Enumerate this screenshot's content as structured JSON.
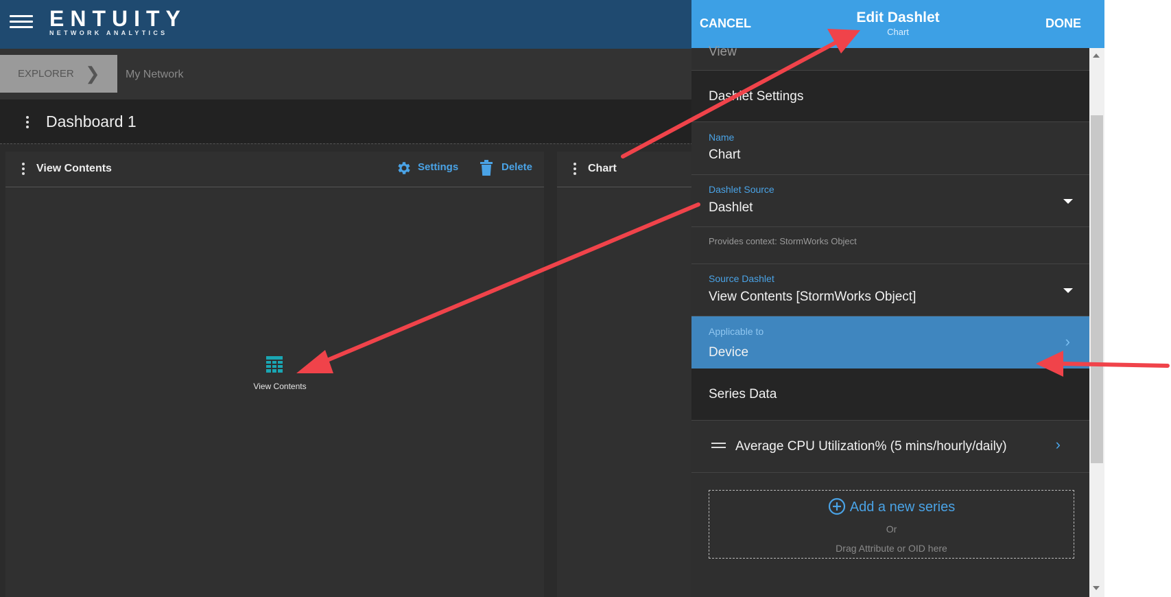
{
  "header": {
    "brand_name": "ENTUITY",
    "brand_tagline": "NETWORK ANALYTICS"
  },
  "breadcrumb": {
    "explorer_label": "EXPLORER",
    "current": "My Network"
  },
  "dashboard": {
    "title": "Dashboard 1"
  },
  "cards": [
    {
      "title": "View Contents",
      "settings_label": "Settings",
      "delete_label": "Delete",
      "content_icon": "table-grid-icon",
      "content_label": "View Contents"
    },
    {
      "title": "Chart"
    }
  ],
  "panel": {
    "cancel_label": "CANCEL",
    "done_label": "DONE",
    "title": "Edit Dashlet",
    "subtitle": "Chart",
    "partial_section": "View",
    "dashlet_settings_title": "Dashlet Settings",
    "name": {
      "label": "Name",
      "value": "Chart"
    },
    "dashlet_source": {
      "label": "Dashlet Source",
      "value": "Dashlet"
    },
    "context_note": "Provides context: StormWorks Object",
    "source_dashlet": {
      "label": "Source Dashlet",
      "value": "View Contents [StormWorks Object]"
    },
    "applicable_to": {
      "label": "Applicable to",
      "value": "Device"
    },
    "series_data_title": "Series Data",
    "series_item": "Average CPU Utilization% (5 mins/hourly/daily)",
    "add_series_label": "Add a new series",
    "or_label": "Or",
    "drag_label": "Drag Attribute or OID here"
  },
  "colors": {
    "accent": "#3da0e5",
    "topbar": "#1f4a70",
    "selected_row": "#3f86bf",
    "annotation_arrow": "#f0434a"
  }
}
